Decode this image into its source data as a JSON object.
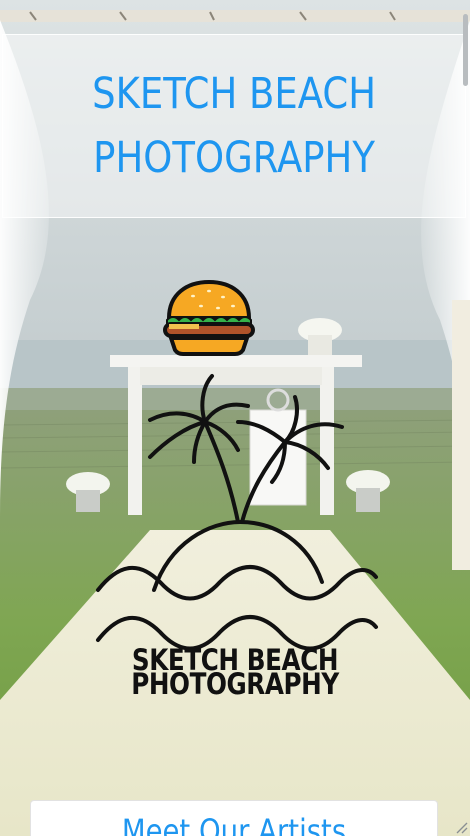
{
  "site": {
    "title_line1": "SKETCH BEACH",
    "title_line2": "PHOTOGRAPHY",
    "title_color": "#1e96f0"
  },
  "menu": {
    "toggle_icon": "hamburger-burger-icon"
  },
  "logo": {
    "line1": "SKETCH BEACH",
    "line2": "PHOTOGRAPHY",
    "icon": "palm-island-waves-icon"
  },
  "section": {
    "heading": "Meet Our Artists"
  },
  "colors": {
    "accent": "#1e96f0",
    "logo_ink": "#111111",
    "panel_bg": "#ffffff"
  }
}
